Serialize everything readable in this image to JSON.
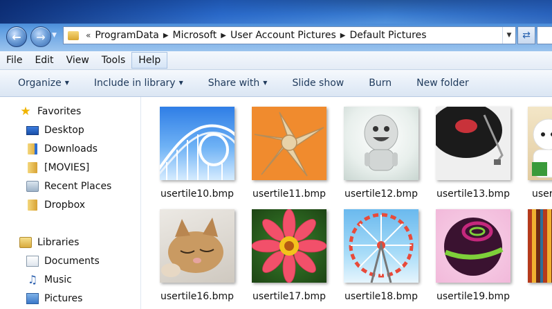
{
  "address": {
    "overflow_chevron": "«",
    "crumbs": [
      "ProgramData",
      "Microsoft",
      "User Account Pictures",
      "Default Pictures"
    ]
  },
  "menu": {
    "items": [
      "File",
      "Edit",
      "View",
      "Tools",
      "Help"
    ]
  },
  "commands": {
    "items": [
      {
        "label": "Organize",
        "has_dropdown": true
      },
      {
        "label": "Include in library",
        "has_dropdown": true
      },
      {
        "label": "Share with",
        "has_dropdown": true
      },
      {
        "label": "Slide show",
        "has_dropdown": false
      },
      {
        "label": "Burn",
        "has_dropdown": false
      },
      {
        "label": "New folder",
        "has_dropdown": false
      }
    ]
  },
  "nav": {
    "favorites": {
      "label": "Favorites",
      "items": [
        "Desktop",
        "Downloads",
        "[MOVIES]",
        "Recent Places",
        "Dropbox"
      ]
    },
    "libraries": {
      "label": "Libraries",
      "items": [
        "Documents",
        "Music",
        "Pictures"
      ]
    }
  },
  "files": {
    "row1": [
      "usertile10.bmp",
      "usertile11.bmp",
      "usertile12.bmp",
      "usertile13.bmp",
      "user"
    ],
    "row2": [
      "usertile16.bmp",
      "usertile17.bmp",
      "usertile18.bmp",
      "usertile19.bmp",
      ""
    ]
  },
  "colors": {
    "title_gradient_top": "#0f3e86",
    "command_text": "#1e395b",
    "favorites_star": "#f0b400"
  }
}
